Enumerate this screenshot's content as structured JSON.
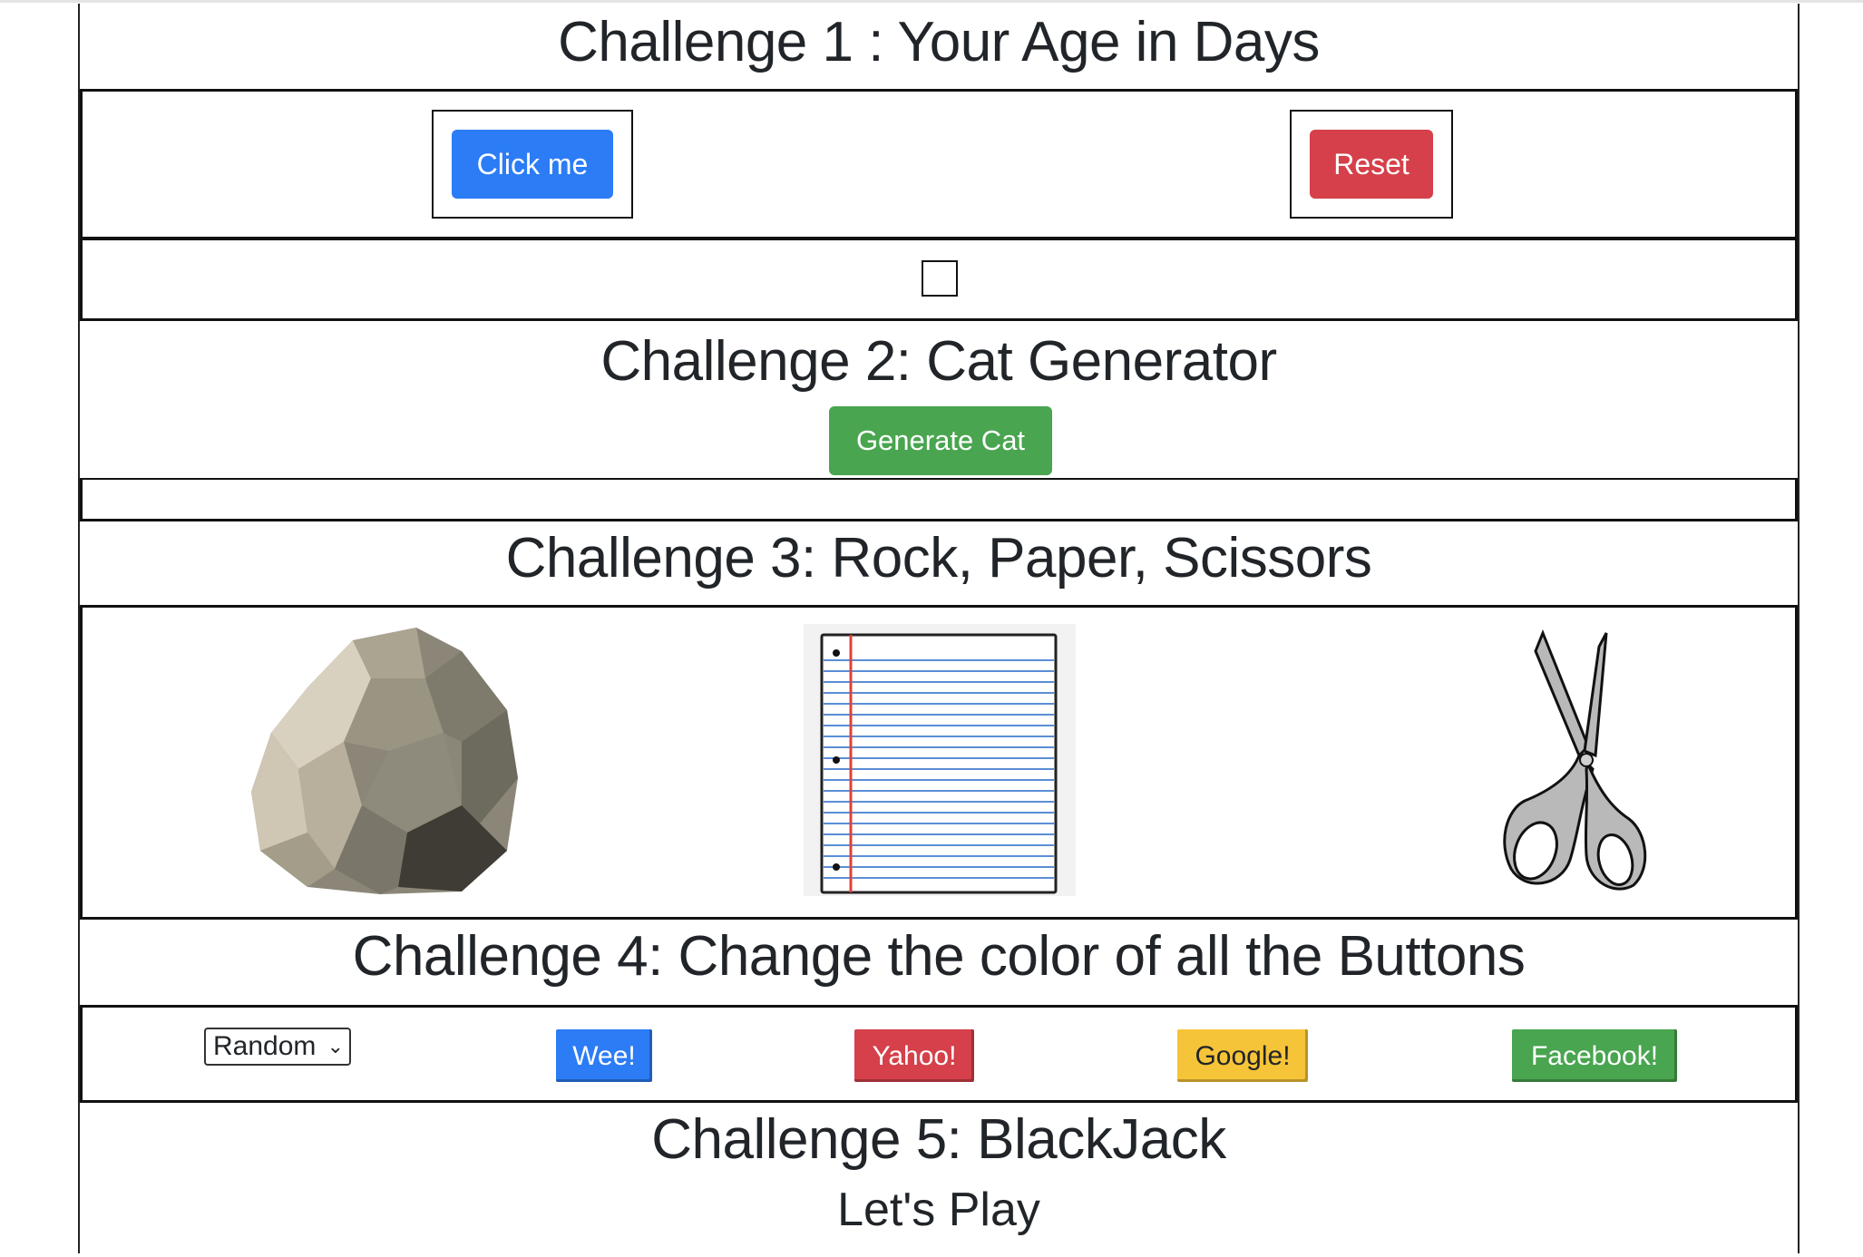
{
  "challenge1": {
    "title": "Challenge 1 : Your Age in Days",
    "click_label": "Click me",
    "reset_label": "Reset"
  },
  "challenge2": {
    "title": "Challenge 2: Cat Generator",
    "generate_label": "Generate Cat"
  },
  "challenge3": {
    "title": "Challenge 3: Rock, Paper, Scissors",
    "choices": [
      "rock",
      "paper",
      "scissors"
    ]
  },
  "challenge4": {
    "title": "Challenge 4: Change the color of all the Buttons",
    "select_value": "Random",
    "buttons": [
      {
        "label": "Wee!",
        "color": "#2b7cf5"
      },
      {
        "label": "Yahoo!",
        "color": "#d5404a"
      },
      {
        "label": "Google!",
        "color": "#f6c438"
      },
      {
        "label": "Facebook!",
        "color": "#49a54f"
      }
    ]
  },
  "challenge5": {
    "title": "Challenge 5: BlackJack",
    "subtitle": "Let's Play"
  },
  "colors": {
    "primary": "#2b7cf5",
    "danger": "#d5404a",
    "success": "#49a54f",
    "warning": "#f6c438",
    "border": "#111111"
  }
}
